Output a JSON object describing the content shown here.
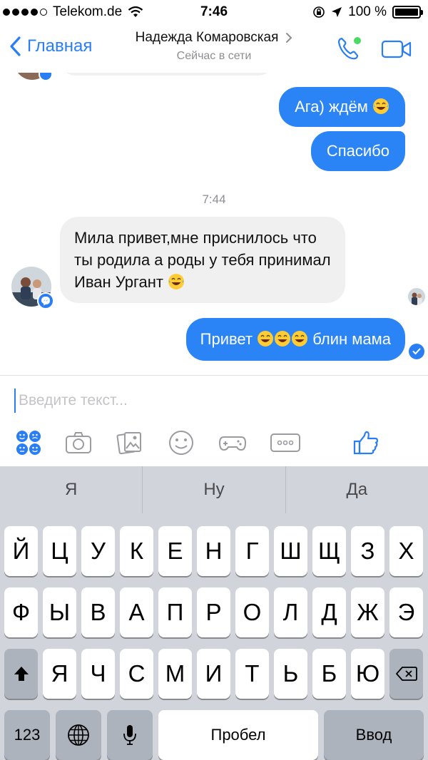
{
  "status_bar": {
    "carrier": "Telekom.de",
    "time": "7:46",
    "battery": "100 %"
  },
  "nav": {
    "back_label": "Главная",
    "title": "Надежда Комаровская",
    "subtitle": "Сейчас в сети"
  },
  "chat": {
    "messages": [
      {
        "direction": "outgoing",
        "text": "Ага) ждём"
      },
      {
        "direction": "outgoing",
        "text": "Спасибо"
      },
      {
        "direction": "incoming",
        "text": "Мила привет,мне приснилось что ты родила а роды у тебя принимал Иван Ургант"
      },
      {
        "direction": "outgoing",
        "text_before": "Привет",
        "text_after": "блин мама"
      }
    ],
    "timestamp": "7:44"
  },
  "composer": {
    "placeholder": "Введите текст..."
  },
  "colors": {
    "accent": "#2a7ef5",
    "outgoing_bubble": "#2a84f5",
    "incoming_bubble": "#f1f0f0",
    "keyboard_bg": "#d1d4db"
  },
  "keyboard": {
    "suggestions": [
      "Я",
      "Ну",
      "Да"
    ],
    "row1": [
      "Й",
      "Ц",
      "У",
      "К",
      "Е",
      "Н",
      "Г",
      "Ш",
      "Щ",
      "З",
      "Х"
    ],
    "row2": [
      "Ф",
      "Ы",
      "В",
      "А",
      "П",
      "Р",
      "О",
      "Л",
      "Д",
      "Ж",
      "Э"
    ],
    "row3": [
      "Я",
      "Ч",
      "С",
      "М",
      "И",
      "Т",
      "Ь",
      "Б",
      "Ю"
    ],
    "numbers_label": "123",
    "space_label": "Пробел",
    "return_label": "Ввод"
  }
}
